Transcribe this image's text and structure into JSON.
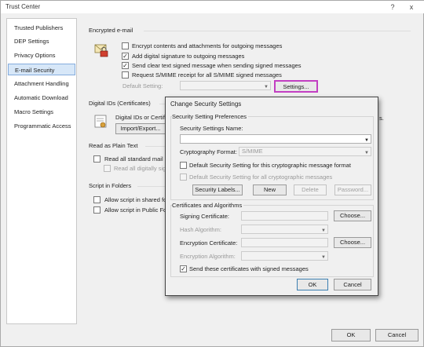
{
  "window": {
    "title": "Trust Center",
    "help_icon": "?",
    "close_icon": "x"
  },
  "sidebar": {
    "items": [
      {
        "label": "Trusted Publishers"
      },
      {
        "label": "DEP Settings"
      },
      {
        "label": "Privacy Options"
      },
      {
        "label": "E-mail Security"
      },
      {
        "label": "Attachment Handling"
      },
      {
        "label": "Automatic Download"
      },
      {
        "label": "Macro Settings"
      },
      {
        "label": "Programmatic Access"
      }
    ]
  },
  "encrypted": {
    "header": "Encrypted e-mail",
    "opt1": "Encrypt contents and attachments for outgoing messages",
    "opt2": "Add digital signature to outgoing messages",
    "opt3": "Send clear text signed message when sending signed messages",
    "opt4": "Request S/MIME receipt for all S/MIME signed messages",
    "default_setting_label": "Default Setting:",
    "default_setting_value": "",
    "settings_button": "Settings..."
  },
  "digital_ids": {
    "header": "Digital IDs (Certificates)",
    "text": "Digital IDs or Certifi",
    "tail": "s.",
    "import_button": "Import/Export..."
  },
  "plain_text": {
    "header": "Read as Plain Text",
    "opt1": "Read all standard mail in",
    "opt2": "Read all digitally sign"
  },
  "script": {
    "header": "Script in Folders",
    "opt1": "Allow script in shared fo",
    "opt2": "Allow script in Public Fo"
  },
  "dialog": {
    "title": "Change Security Settings",
    "prefs_group": "Security Setting Preferences",
    "name_label": "Security Settings Name:",
    "name_value": "",
    "format_label": "Cryptography Format:",
    "format_value": "S/MIME",
    "default_format_cb": "Default Security Setting for this cryptographic message format",
    "default_all_cb": "Default Security Setting for all cryptographic messages",
    "security_labels_button": "Security Labels...",
    "new_button": "New",
    "delete_button": "Delete",
    "password_button": "Password...",
    "certs_group": "Certificates and Algorithms",
    "signing_label": "Signing Certificate:",
    "signing_value": "",
    "choose1_button": "Choose...",
    "hash_label": "Hash Algorithm:",
    "hash_value": "",
    "encryption_label": "Encryption Certificate:",
    "encryption_value": "",
    "choose2_button": "Choose...",
    "enc_alg_label": "Encryption Algorithm:",
    "enc_alg_value": "",
    "send_certs_cb": "Send these certificates with signed messages",
    "ok_button": "OK",
    "cancel_button": "Cancel"
  },
  "footer": {
    "ok_button": "OK",
    "cancel_button": "Cancel"
  },
  "colors": {
    "selection": "#d7e7f8",
    "settings_highlight": "#c23fc2",
    "dialog_border": "#444444"
  }
}
